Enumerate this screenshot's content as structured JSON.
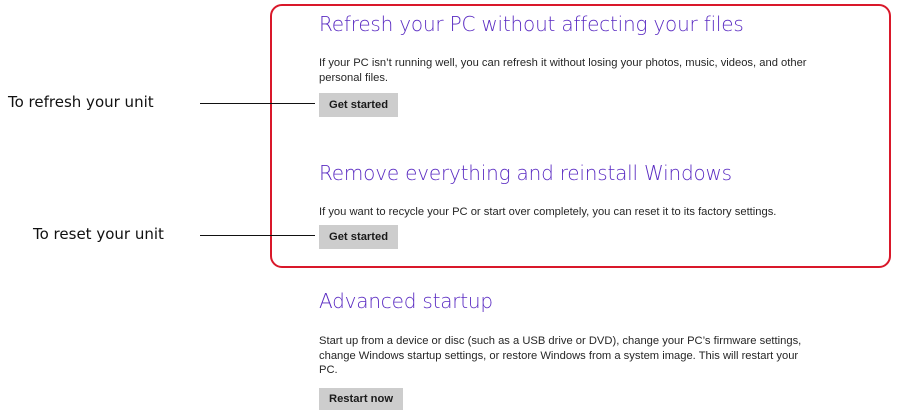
{
  "sections": {
    "refresh": {
      "title": "Refresh your PC without affecting your files",
      "description": "If your PC isn’t running well, you can refresh it without losing your photos, music, videos, and other personal files.",
      "button_label": "Get started"
    },
    "reset": {
      "title": "Remove everything and reinstall Windows",
      "description": "If you want to recycle your PC or start over completely, you can reset it to its factory settings.",
      "button_label": "Get started"
    },
    "advanced": {
      "title": "Advanced startup",
      "description": "Start up from a device or disc (such as a USB drive or DVD), change your PC’s firmware settings, change Windows startup settings, or restore Windows from a system image. This will restart your PC.",
      "button_label": "Restart now"
    }
  },
  "callouts": {
    "refresh": "To refresh your unit",
    "reset": "To reset your unit"
  },
  "colors": {
    "heading_accent": "#5a2bc2",
    "highlight_border": "#d9182a",
    "button_bg": "#cdcdcd"
  }
}
